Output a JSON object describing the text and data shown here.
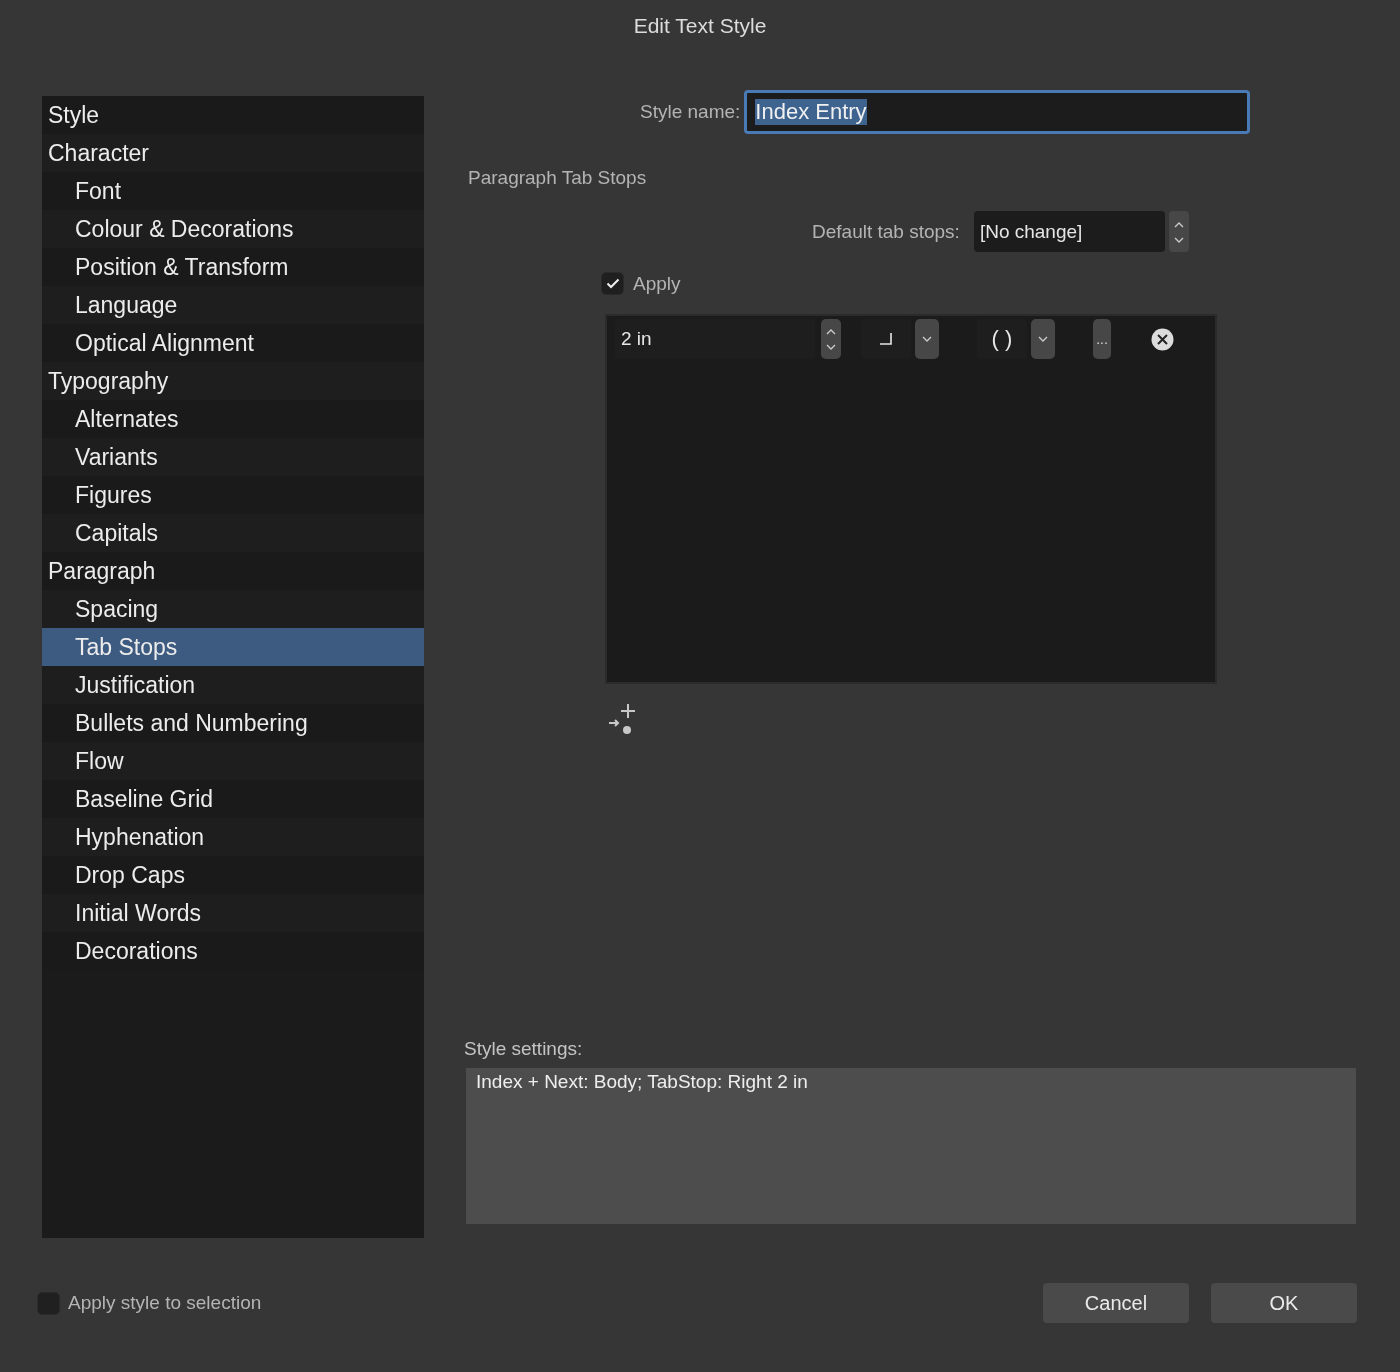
{
  "window": {
    "title": "Edit Text Style"
  },
  "sidebar": {
    "items": [
      {
        "label": "Style",
        "selected": false
      },
      {
        "label": "Character",
        "selected": false,
        "children": [
          {
            "label": "Font",
            "selected": false
          },
          {
            "label": "Colour & Decorations",
            "selected": false
          },
          {
            "label": "Position & Transform",
            "selected": false
          },
          {
            "label": "Language",
            "selected": false
          },
          {
            "label": "Optical Alignment",
            "selected": false
          }
        ]
      },
      {
        "label": "Typography",
        "selected": false,
        "children": [
          {
            "label": "Alternates",
            "selected": false
          },
          {
            "label": "Variants",
            "selected": false
          },
          {
            "label": "Figures",
            "selected": false
          },
          {
            "label": "Capitals",
            "selected": false
          }
        ]
      },
      {
        "label": "Paragraph",
        "selected": false,
        "children": [
          {
            "label": "Spacing",
            "selected": false
          },
          {
            "label": "Tab Stops",
            "selected": true
          },
          {
            "label": "Justification",
            "selected": false
          },
          {
            "label": "Bullets and Numbering",
            "selected": false
          },
          {
            "label": "Flow",
            "selected": false
          },
          {
            "label": "Baseline Grid",
            "selected": false
          },
          {
            "label": "Hyphenation",
            "selected": false
          },
          {
            "label": "Drop Caps",
            "selected": false
          },
          {
            "label": "Initial Words",
            "selected": false
          },
          {
            "label": "Decorations",
            "selected": false
          }
        ]
      }
    ]
  },
  "style_name": {
    "label": "Style name:",
    "value": "Index Entry",
    "text_selected": true
  },
  "section_title": "Paragraph Tab Stops",
  "default_tab_stops": {
    "label": "Default tab stops:",
    "value": "[No change]"
  },
  "apply": {
    "label": "Apply",
    "checked": true
  },
  "tab_stops": [
    {
      "position": "2 in",
      "kind": "right",
      "leader": "( )",
      "more": "..."
    }
  ],
  "style_settings": {
    "label": "Style settings:",
    "value": "Index + Next: Body; TabStop: Right 2 in"
  },
  "apply_to_selection": {
    "label": "Apply style to selection",
    "checked": false
  },
  "buttons": [
    {
      "label": "Cancel"
    },
    {
      "label": "OK"
    }
  ]
}
